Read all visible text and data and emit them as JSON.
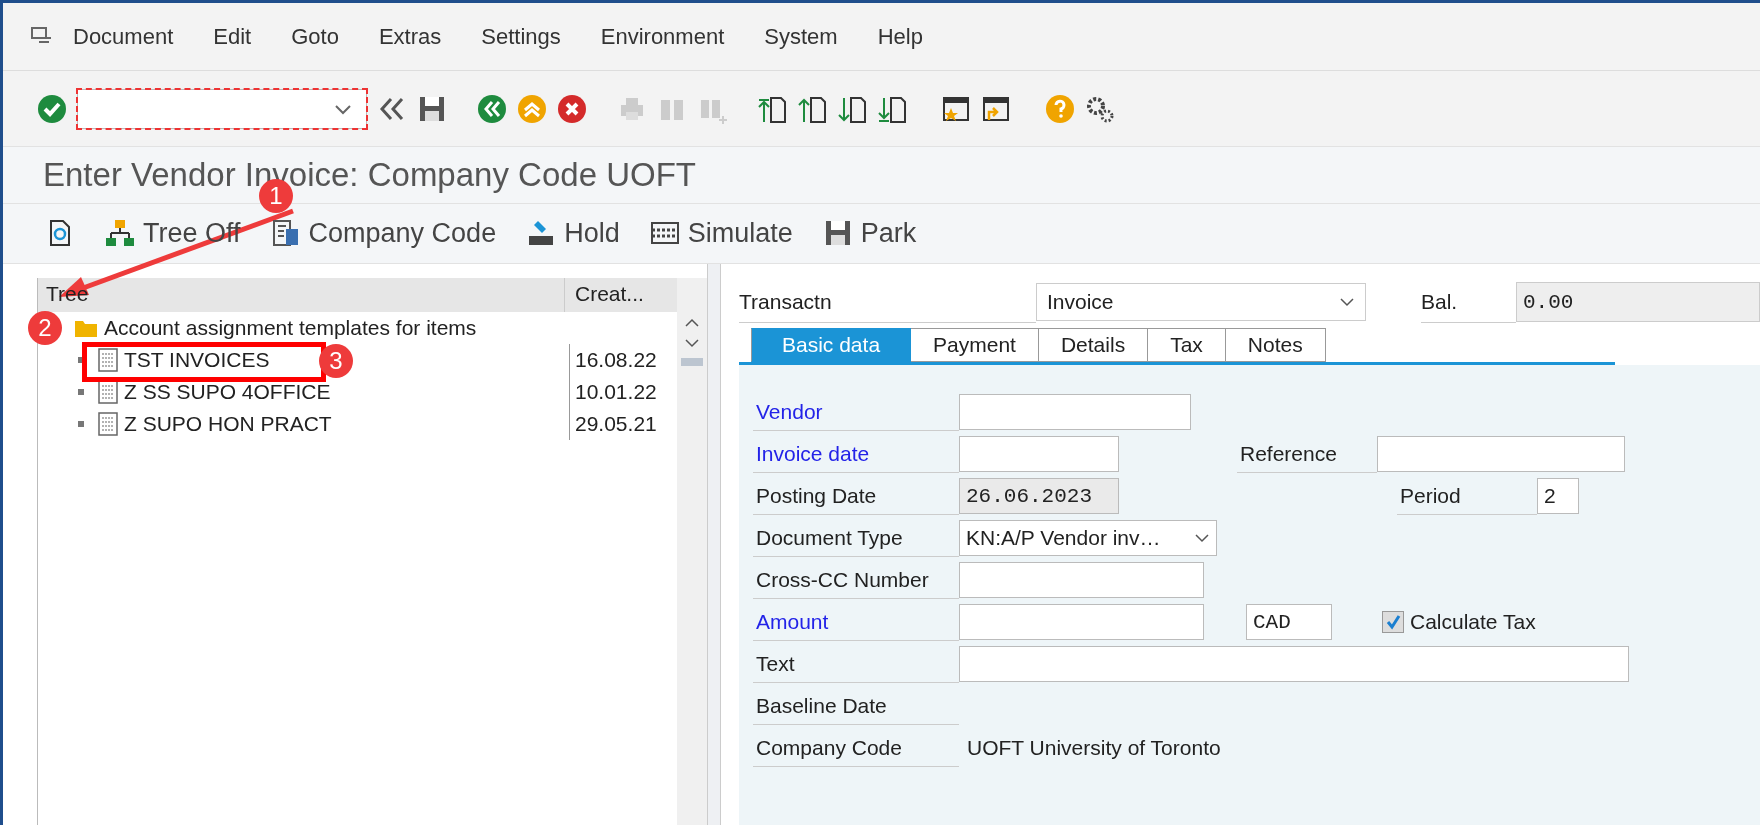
{
  "menu_bar": [
    "Document",
    "Edit",
    "Goto",
    "Extras",
    "Settings",
    "Environment",
    "System",
    "Help"
  ],
  "title": "Enter Vendor Invoice: Company Code UOFT",
  "app_toolbar": [
    "Tree Off",
    "Company Code",
    "Hold",
    "Simulate",
    "Park"
  ],
  "tree": {
    "columns": [
      "Tree",
      "Creat..."
    ],
    "nodes": [
      {
        "label": "Account assignment templates for items",
        "children": [
          {
            "label": "TST INVOICES",
            "date": "16.08.22"
          },
          {
            "label": "Z SS SUPO 4OFFICE",
            "date": "10.01.22"
          },
          {
            "label": "Z SUPO HON PRACT",
            "date": "29.05.21"
          }
        ]
      }
    ]
  },
  "transaction": {
    "label": "Transactn",
    "value": "Invoice"
  },
  "balance": {
    "label": "Bal.",
    "value": "0.00"
  },
  "tabs": [
    {
      "label": "Basic data",
      "selected": true
    },
    {
      "label": "Payment",
      "selected": false
    },
    {
      "label": "Details",
      "selected": false
    },
    {
      "label": "Tax",
      "selected": false
    },
    {
      "label": "Notes",
      "selected": false
    }
  ],
  "rows": [
    {
      "label": "Vendor",
      "link": true,
      "field": {
        "kind": "input"
      }
    },
    {
      "label": "Invoice date",
      "link": true,
      "field": {
        "kind": "input"
      },
      "side": {
        "label": "Reference",
        "field": {
          "kind": "input"
        }
      }
    },
    {
      "label": "Posting Date",
      "link": false,
      "field": {
        "kind": "readonly",
        "value": "26.06.2023"
      },
      "side": {
        "label": "Period",
        "field": {
          "kind": "input",
          "value": "2"
        }
      }
    },
    {
      "label": "Document Type",
      "link": false,
      "field": {
        "kind": "select",
        "value": "KN:A/P Vendor inv…"
      }
    },
    {
      "label": "Cross-CC Number",
      "link": false,
      "field": {
        "kind": "input"
      }
    },
    {
      "label": "Amount",
      "link": true,
      "field": {
        "kind": "input"
      },
      "currency": "CAD",
      "checkbox": {
        "label": "Calculate Tax",
        "checked": true
      }
    },
    {
      "label": "Text",
      "link": false,
      "field": {
        "kind": "input"
      }
    },
    {
      "label": "Baseline Date",
      "link": false
    },
    {
      "label": "Company Code",
      "link": false,
      "field": {
        "kind": "text",
        "value": "UOFT University of Toronto"
      }
    }
  ],
  "annotations": [
    {
      "number": "1"
    },
    {
      "number": "2"
    },
    {
      "number": "3"
    }
  ]
}
